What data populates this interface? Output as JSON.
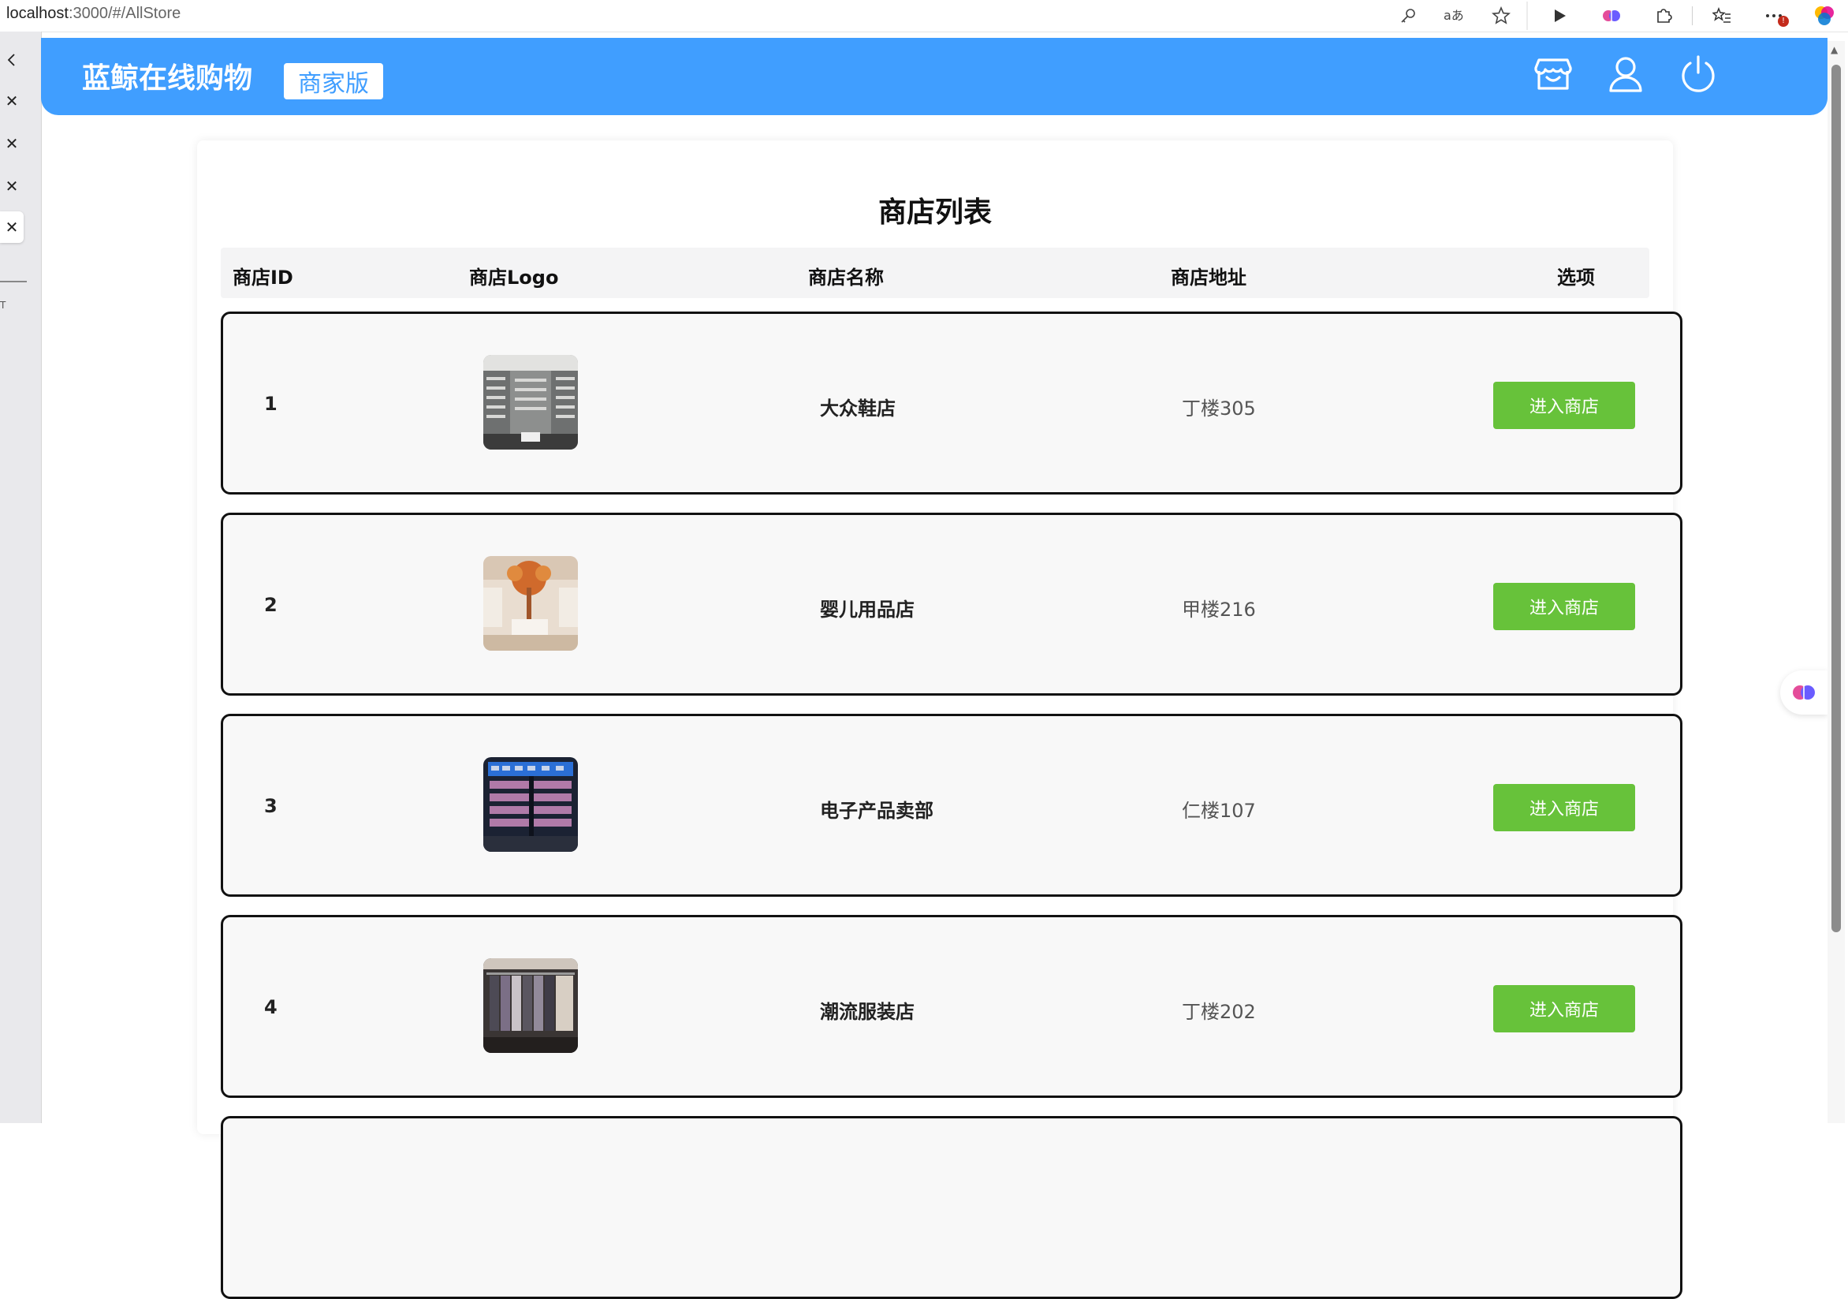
{
  "browser": {
    "url_host": "localhost",
    "url_path": ":3000/#/AllStore"
  },
  "header": {
    "brand": "蓝鲸在线购物",
    "edition": "商家版",
    "accent_color": "#409eff",
    "icons": [
      "store-icon",
      "user-icon",
      "power-icon"
    ]
  },
  "page": {
    "title": "商店列表",
    "columns": {
      "id": "商店ID",
      "logo": "商店Logo",
      "name": "商店名称",
      "address": "商店地址",
      "options": "选项"
    }
  },
  "stores": [
    {
      "id": "1",
      "name": "大众鞋店",
      "address": "丁楼305",
      "button": "进入商店",
      "logo_icon": "shoe-store-photo"
    },
    {
      "id": "2",
      "name": "婴儿用品店",
      "address": "甲楼216",
      "button": "进入商店",
      "logo_icon": "baby-store-photo"
    },
    {
      "id": "3",
      "name": "电子产品卖部",
      "address": "仁楼107",
      "button": "进入商店",
      "logo_icon": "electronics-store-photo"
    },
    {
      "id": "4",
      "name": "潮流服装店",
      "address": "丁楼202",
      "button": "进入商店",
      "logo_icon": "clothing-store-photo"
    }
  ],
  "button_color": "#67c23a"
}
